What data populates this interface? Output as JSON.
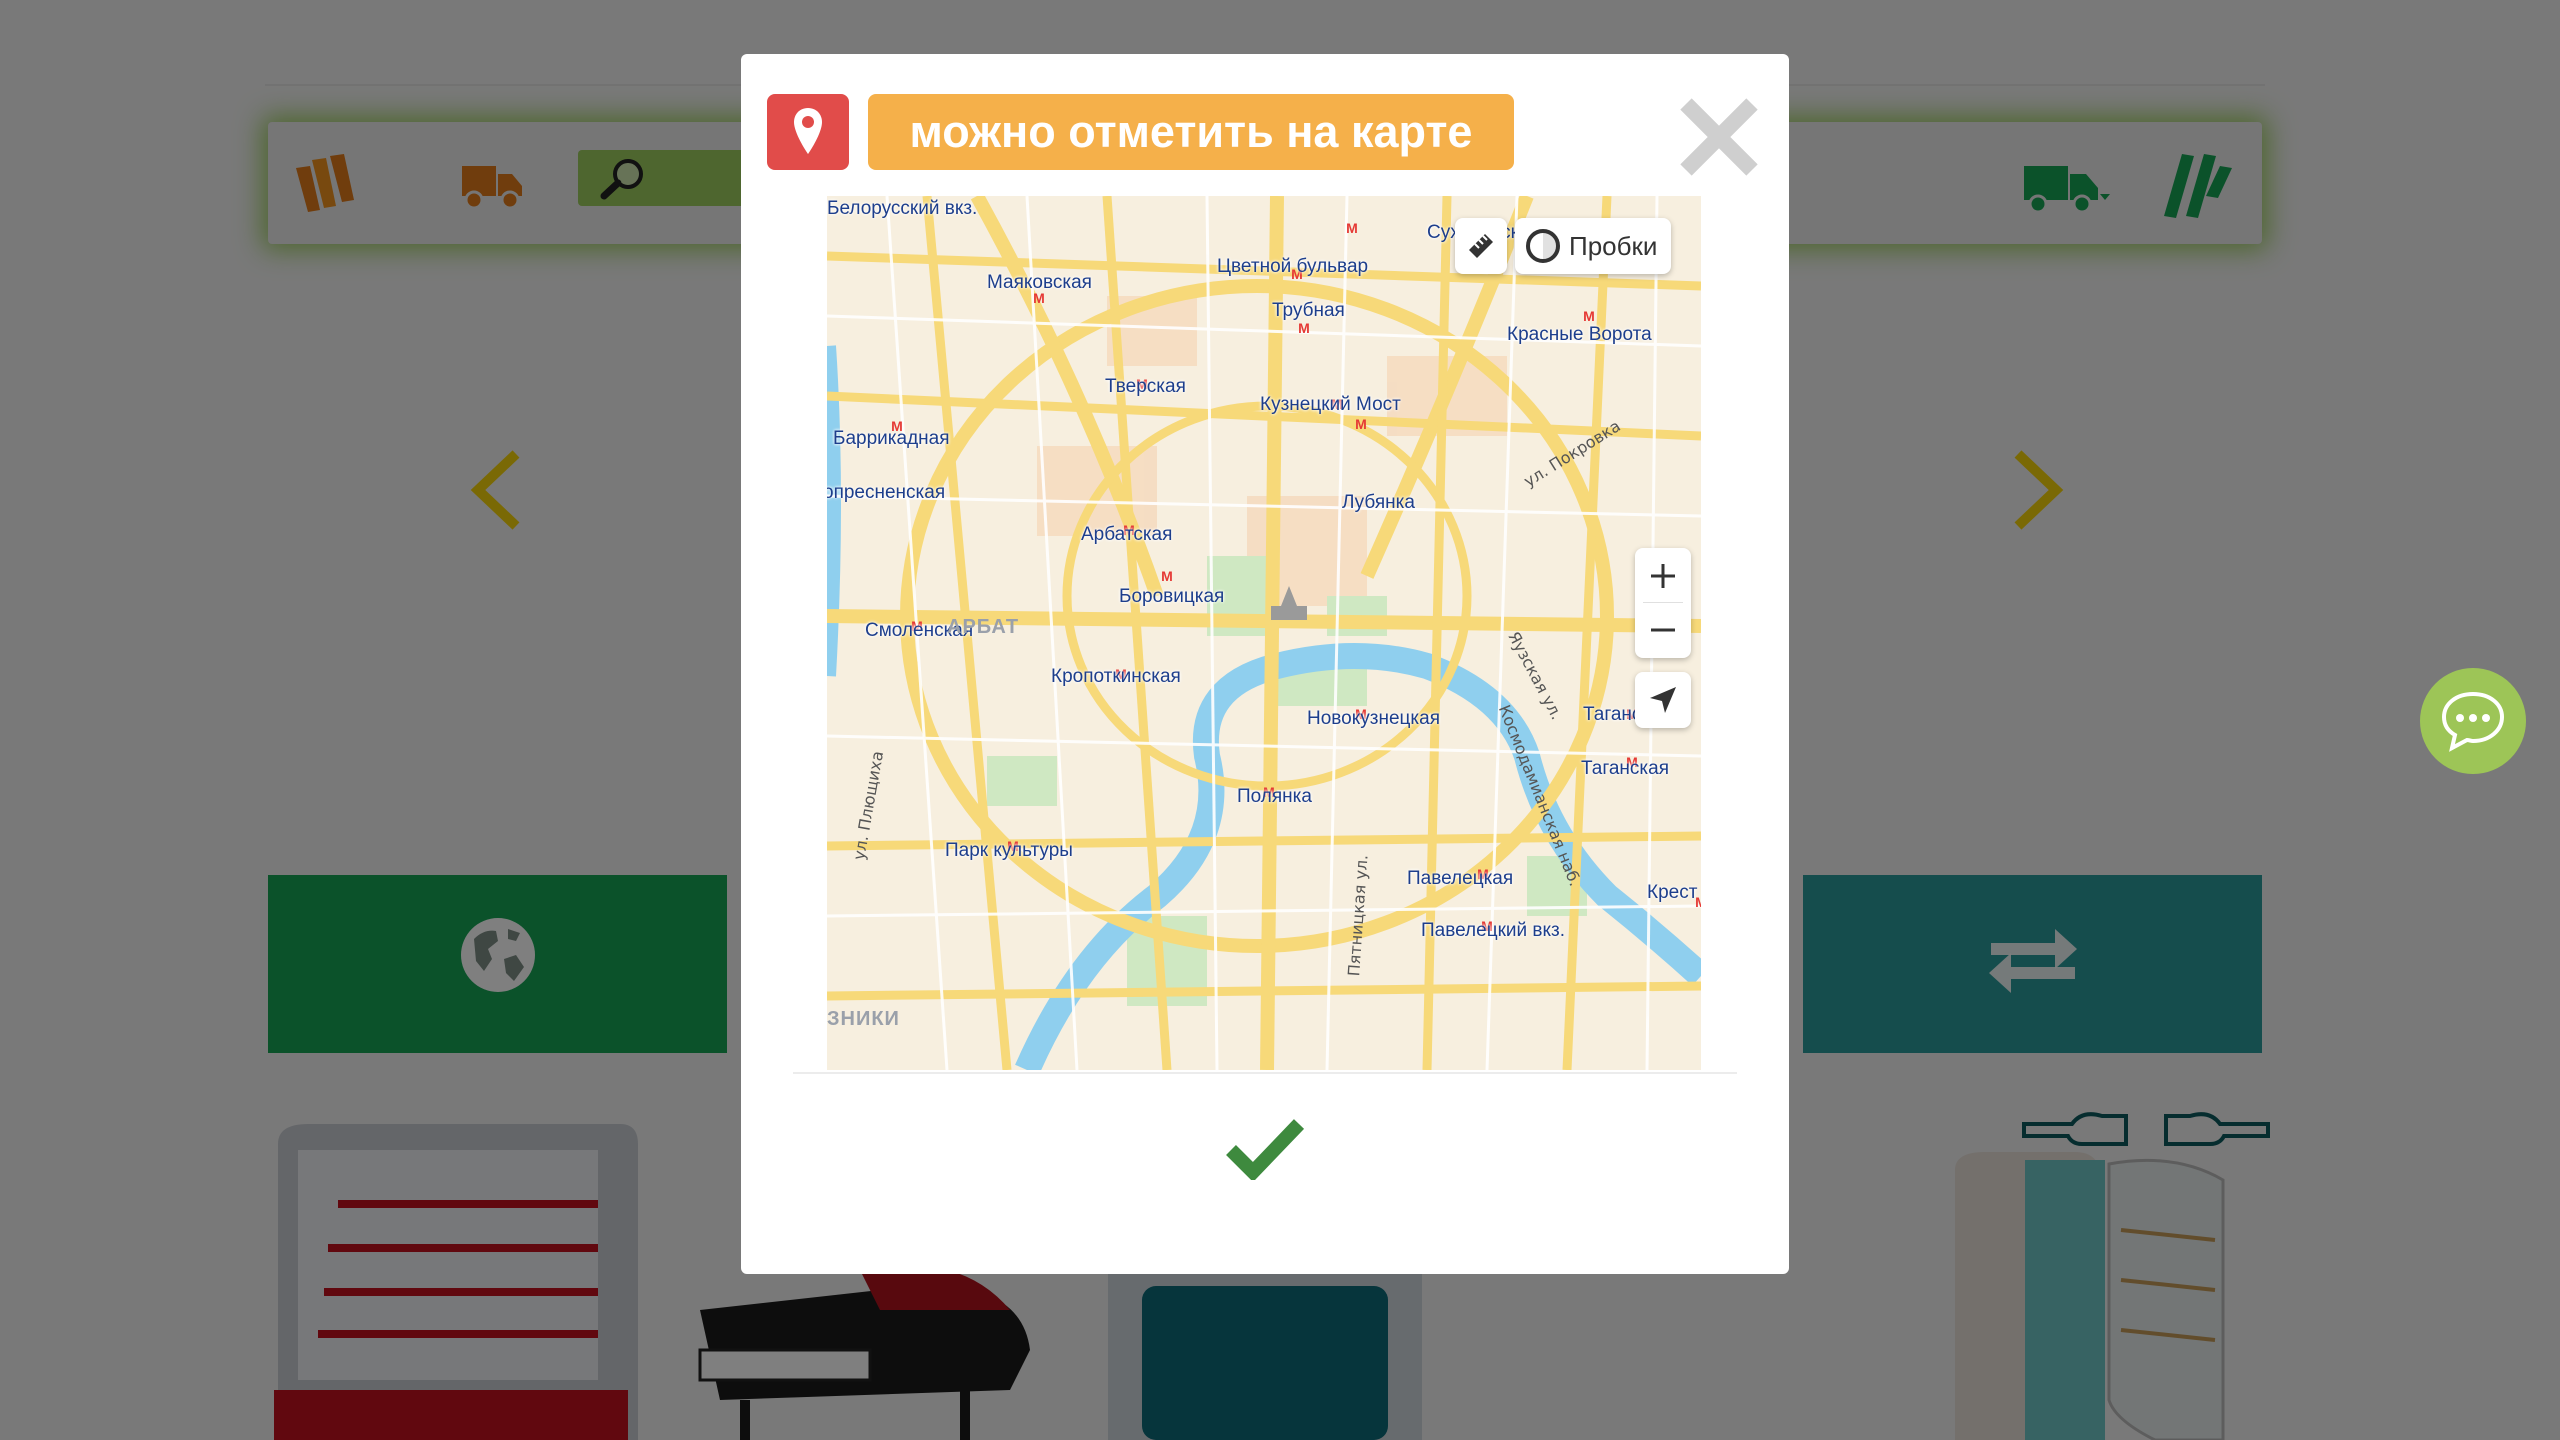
{
  "modal": {
    "banner_text": "можно отметить на карте",
    "map": {
      "traffic_label": "Пробки",
      "district_label": "АРБАТ",
      "district_label2": "ЗНИКИ",
      "metro_stations": [
        {
          "name": "Сухаревская"
        },
        {
          "name": "Цветной бульвар"
        },
        {
          "name": "Маяковская"
        },
        {
          "name": "Трубная"
        },
        {
          "name": "Красные Ворота"
        },
        {
          "name": "Тверская"
        },
        {
          "name": "Кузнецкий Мост"
        },
        {
          "name": "Баррикадная"
        },
        {
          "name": "Краснопресненская",
          "display": "опресненская"
        },
        {
          "name": "Лубянка"
        },
        {
          "name": "Арбатская"
        },
        {
          "name": "Боровицкая"
        },
        {
          "name": "Смоленская"
        },
        {
          "name": "Кропоткинская"
        },
        {
          "name": "Новокузнецкая"
        },
        {
          "name": "Таганская"
        },
        {
          "name": "Таганская 2",
          "display": "Таганская"
        },
        {
          "name": "Полянка"
        },
        {
          "name": "Парк культуры"
        },
        {
          "name": "Павелецкая"
        },
        {
          "name": "Павелецкий вкз."
        },
        {
          "name": "Крест",
          "display": "Крест"
        },
        {
          "name": "Белорусский вкз.",
          "display": "Белорусский вкз."
        }
      ],
      "street_labels": [
        "ул. Покровка",
        "Яузская ул.",
        "Космодамианская наб.",
        "ул. Плющиха",
        "Пятницкая ул."
      ]
    }
  },
  "icons": {
    "pin": "map-pin-icon",
    "close": "close-icon",
    "confirm": "checkmark-icon",
    "ruler": "ruler-icon",
    "traffic": "traffic-light-icon",
    "zoom_in": "plus-icon",
    "zoom_out": "minus-icon",
    "locate": "geolocation-icon",
    "chat": "chat-bubble-icon"
  },
  "colors": {
    "banner": "#f5b04a",
    "pin_box": "#e14c4a",
    "confirm": "#3e8a3e",
    "green_tile": "#17a455",
    "teal_tile": "#2a9b9a",
    "chat": "#9dc557"
  }
}
